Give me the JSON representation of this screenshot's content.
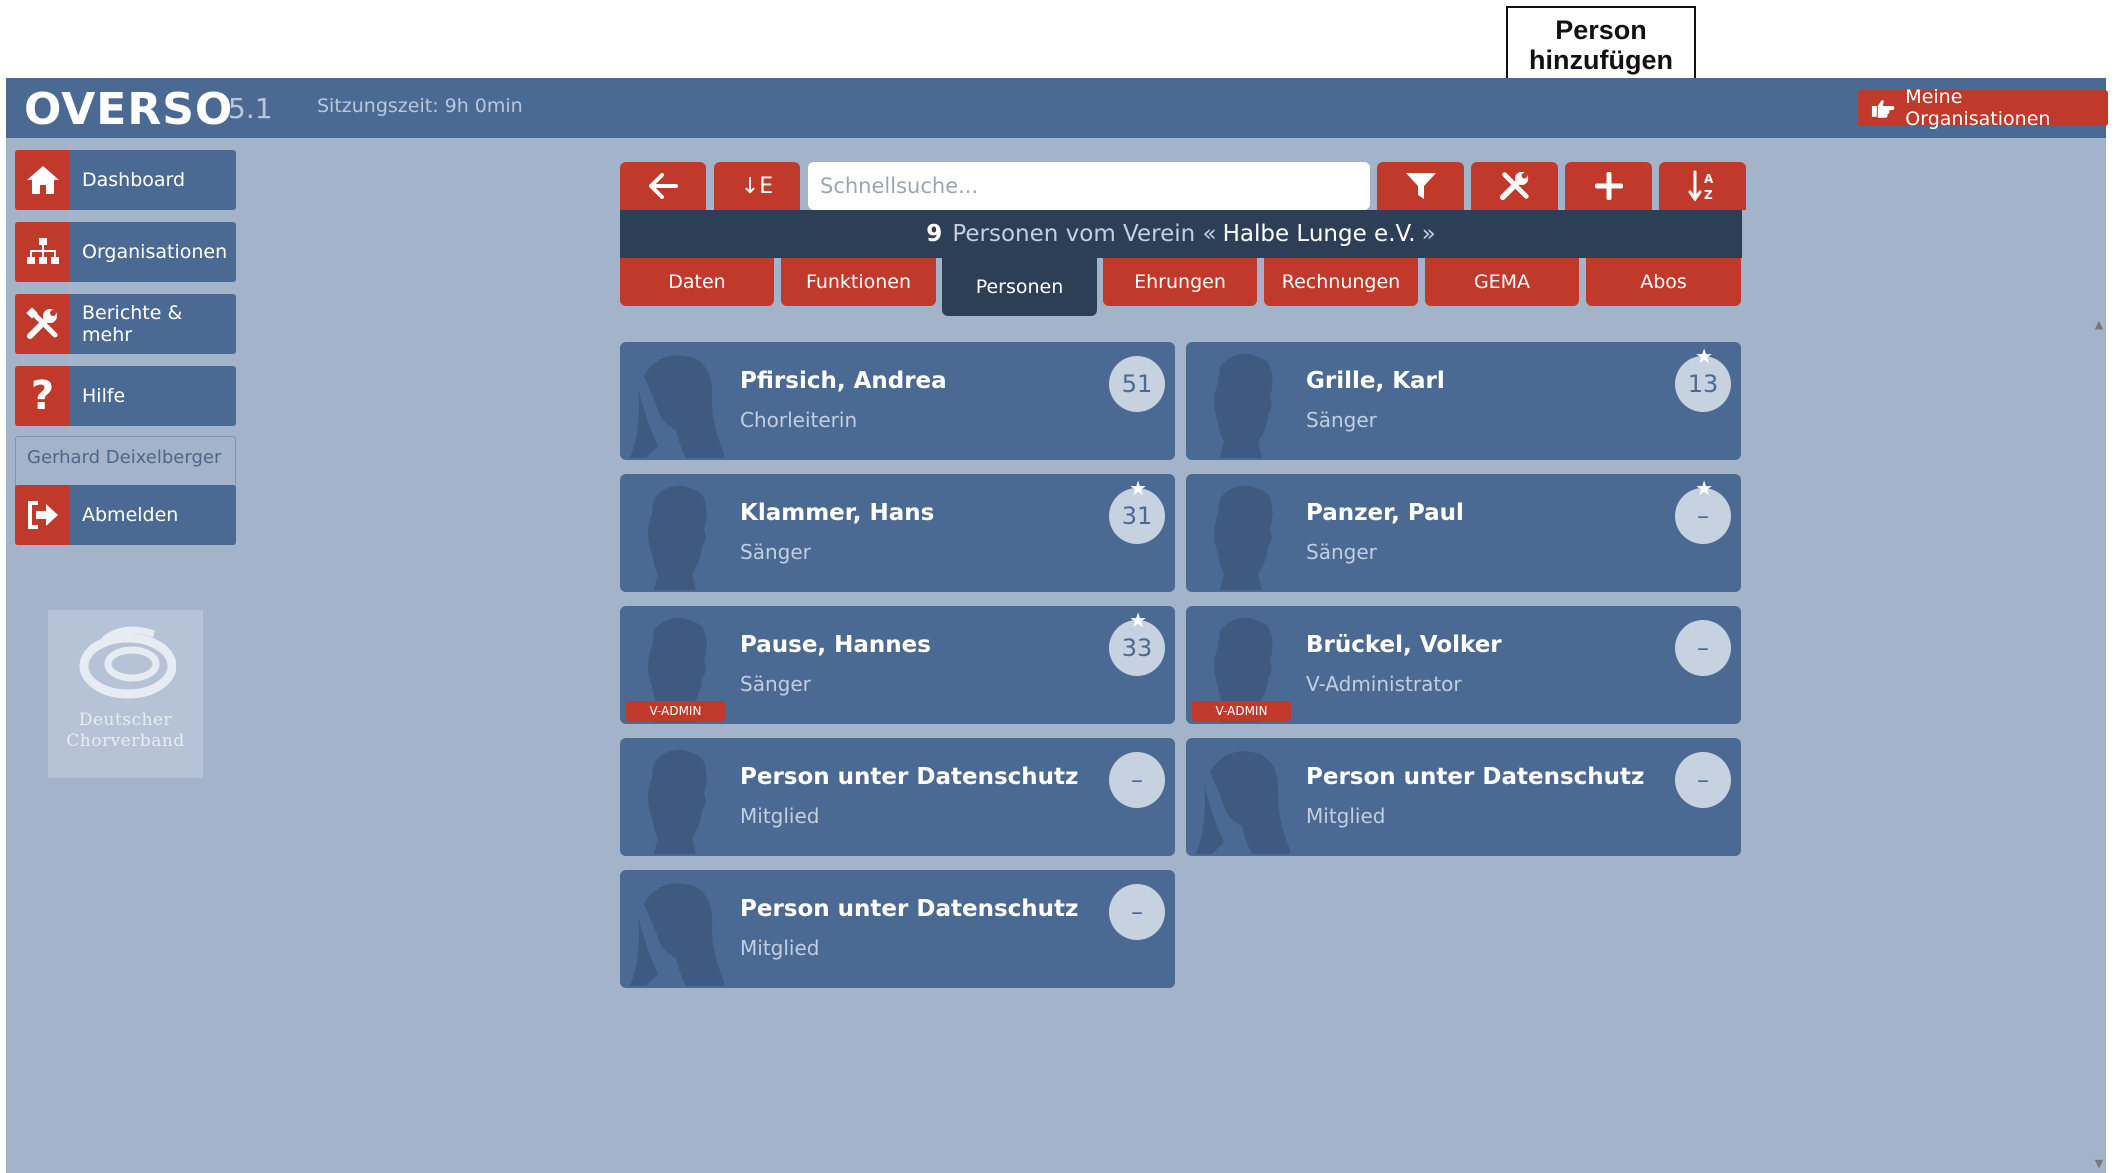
{
  "callout": {
    "text_line1": "Person",
    "text_line2": "hinzufügen"
  },
  "header": {
    "logo": "OVERSO",
    "version": "5.1",
    "session": "Sitzungszeit: 9h 0min",
    "my_orgs": "Meine Organisationen"
  },
  "sidebar": {
    "items": [
      {
        "label": "Dashboard",
        "icon": "home-icon"
      },
      {
        "label": "Organisationen",
        "icon": "org-chart-icon"
      },
      {
        "label": "Berichte & mehr",
        "icon": "tools-icon"
      },
      {
        "label": "Hilfe",
        "icon": "question-icon"
      }
    ],
    "user_name": "Gerhard Deixelberger",
    "logout": "Abmelden",
    "logo_line1": "Deutscher",
    "logo_line2": "Chorverband"
  },
  "toolbar": {
    "sort_label": "↓E",
    "search_placeholder": "Schnellsuche..."
  },
  "title": {
    "count": "9",
    "text_pre": "Personen vom Verein «",
    "org": "Halbe Lunge e.V.",
    "text_post": "»"
  },
  "tabs": [
    {
      "label": "Daten"
    },
    {
      "label": "Funktionen"
    },
    {
      "label": "Personen"
    },
    {
      "label": "Ehrungen"
    },
    {
      "label": "Rechnungen"
    },
    {
      "label": "GEMA"
    },
    {
      "label": "Abos"
    }
  ],
  "persons": [
    {
      "name": "Pfirsich, Andrea",
      "role": "Chorleiterin",
      "badge": "51",
      "star": false,
      "vadmin": false,
      "avatar": "female"
    },
    {
      "name": "Grille, Karl",
      "role": "Sänger",
      "badge": "13",
      "star": true,
      "vadmin": false,
      "avatar": "male"
    },
    {
      "name": "Klammer, Hans",
      "role": "Sänger",
      "badge": "31",
      "star": true,
      "vadmin": false,
      "avatar": "male"
    },
    {
      "name": "Panzer, Paul",
      "role": "Sänger",
      "badge": "–",
      "star": true,
      "vadmin": false,
      "avatar": "male"
    },
    {
      "name": "Pause, Hannes",
      "role": "Sänger",
      "badge": "33",
      "star": true,
      "vadmin": true,
      "avatar": "male"
    },
    {
      "name": "Brückel, Volker",
      "role": "V-Administrator",
      "badge": "–",
      "star": false,
      "vadmin": true,
      "avatar": "male"
    },
    {
      "name": "Person unter Datenschutz",
      "role": "Mitglied",
      "badge": "–",
      "star": false,
      "vadmin": false,
      "avatar": "male"
    },
    {
      "name": "Person unter Datenschutz",
      "role": "Mitglied",
      "badge": "–",
      "star": false,
      "vadmin": false,
      "avatar": "female"
    },
    {
      "name": "Person unter Datenschutz",
      "role": "Mitglied",
      "badge": "–",
      "star": false,
      "vadmin": false,
      "avatar": "female"
    }
  ],
  "vadmin_label": "V-ADMIN",
  "colors": {
    "accent": "#c0392b",
    "panel": "#4b6a93",
    "background": "#a3b3c9",
    "title_bar": "#2c3f57"
  }
}
